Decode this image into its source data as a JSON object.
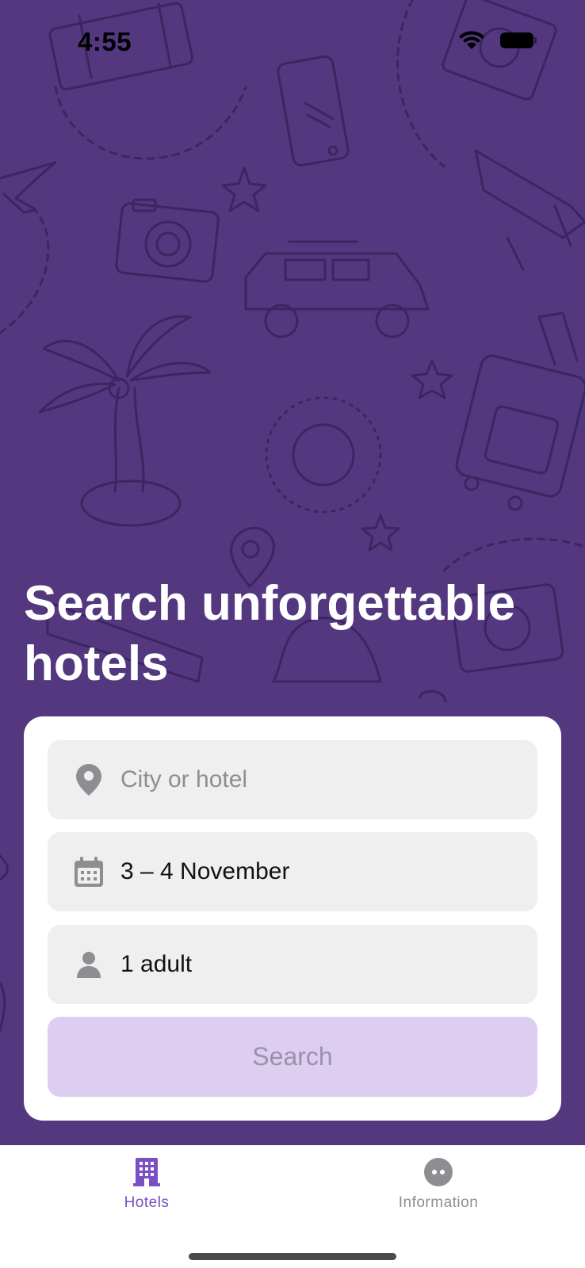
{
  "status_bar": {
    "time": "4:55"
  },
  "hero": {
    "headline": "Search unforgettable hotels"
  },
  "search_form": {
    "destination": {
      "placeholder": "City or hotel",
      "value": "",
      "icon": "location-pin-icon"
    },
    "dates": {
      "value": "3 – 4 November",
      "icon": "calendar-icon"
    },
    "guests": {
      "value": "1 adult",
      "icon": "person-icon"
    },
    "search_label": "Search"
  },
  "tab_bar": {
    "tabs": [
      {
        "label": "Hotels",
        "icon": "hotel-building-icon",
        "selected": true
      },
      {
        "label": "Information",
        "icon": "info-circle-icon",
        "selected": false
      }
    ]
  },
  "colors": {
    "hero_background": "#53387f",
    "accent": "#7a4fc4",
    "search_button_bg": "#dccdf1",
    "field_bg": "#efefef"
  }
}
